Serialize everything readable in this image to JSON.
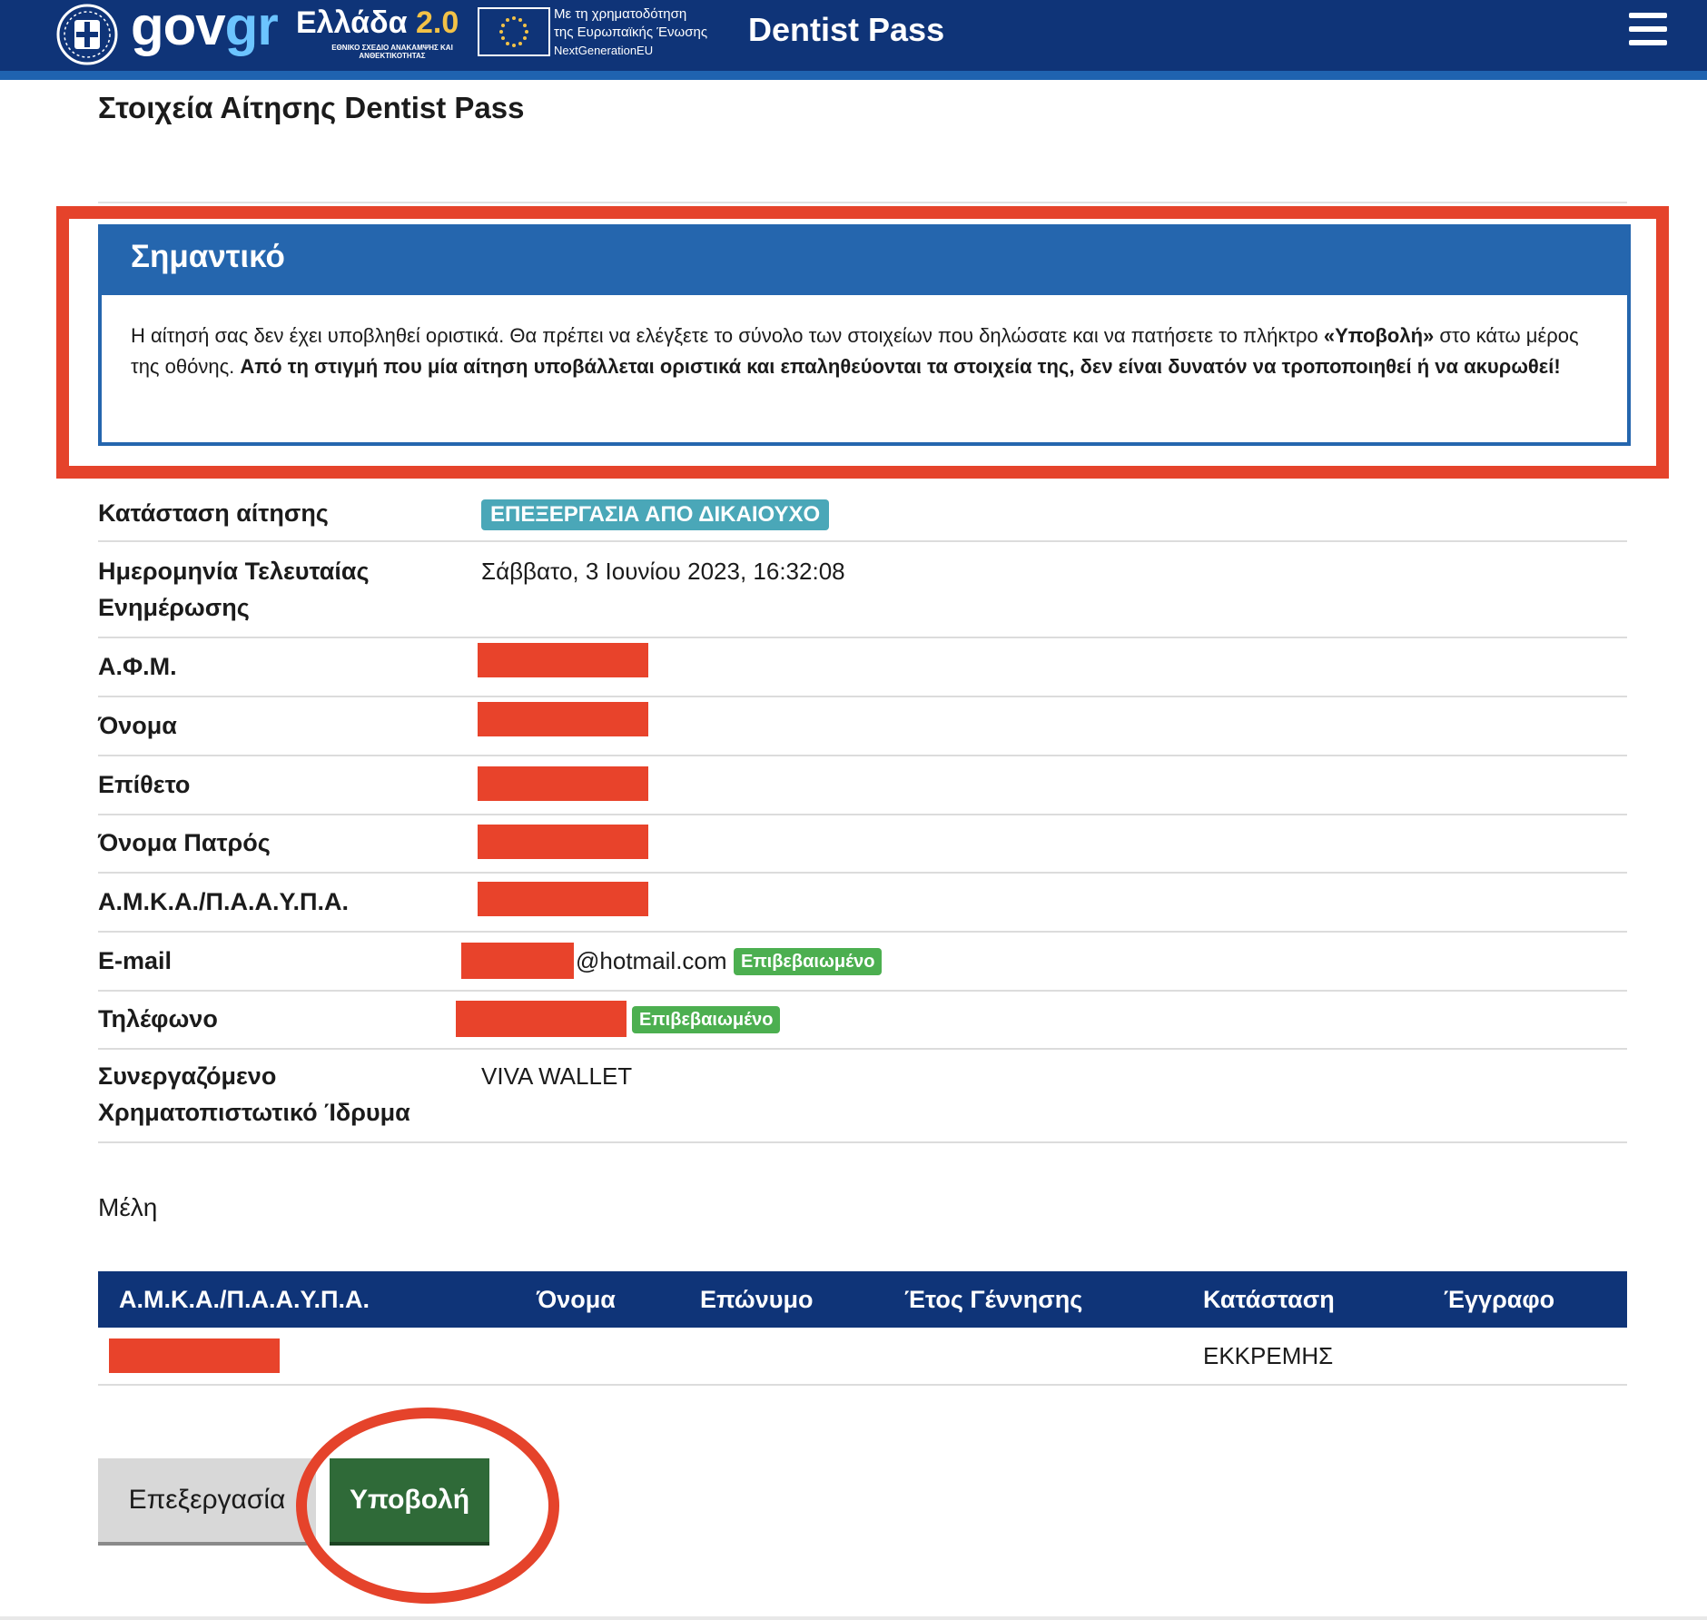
{
  "colors": {
    "header_bg": "#0f3478",
    "header_stripe": "#1f63b0",
    "notice_blue": "#2566ae",
    "annotation_red": "#e5432b",
    "status_teal": "#4aa7b8",
    "verified_green": "#4caf50",
    "submit_green": "#2f6a38"
  },
  "header": {
    "logo_gov": "gov",
    "logo_gr": "gr",
    "ellada_word": "Ελλάδα",
    "ellada_version": "2.0",
    "ellada_subtitle": "ΕΘΝΙΚΟ ΣΧΕΔΙΟ ΑΝΑΚΑΜΨΗΣ ΚΑΙ ΑΝΘΕΚΤΙΚΟΤΗΤΑΣ",
    "eu_line1": "Με τη χρηματοδότηση",
    "eu_line2": "της Ευρωπαϊκής Ένωσης",
    "eu_line3": "NextGenerationEU",
    "app_title": "Dentist Pass",
    "menu_icon": "hamburger-menu-icon"
  },
  "page_title": "Στοιχεία Αίτησης Dentist Pass",
  "notice": {
    "heading": "Σημαντικό",
    "text_part1": "Η αίτησή σας δεν έχει υποβληθεί οριστικά. Θα πρέπει να ελέγξετε το σύνολο των στοιχείων που δηλώσατε και να πατήσετε το πλήκτρο ",
    "text_bold_button": "«Υποβολή»",
    "text_part2": " στο κάτω μέρος της οθόνης. ",
    "text_bold_warning": "Από τη στιγμή που μία αίτηση υποβάλλεται οριστικά και επαληθεύονται τα στοιχεία της, δεν είναι δυνατόν να τροποποιηθεί ή να ακυρωθεί!"
  },
  "details": {
    "status_label": "Κατάσταση αίτησης",
    "status_value": "ΕΠΕΞΕΡΓΑΣΙΑ ΑΠΟ ΔΙΚΑΙΟΥΧΟ",
    "updated_label": "Ημερομηνία Τελευταίας Ενημέρωσης",
    "updated_value": "Σάββατο, 3 Ιουνίου 2023, 16:32:08",
    "afm_label": "Α.Φ.Μ.",
    "name_label": "Όνομα",
    "surname_label": "Επίθετο",
    "father_label": "Όνομα Πατρός",
    "amka_label": "Α.Μ.Κ.Α./Π.Α.Α.Υ.Π.Α.",
    "email_label": "E-mail",
    "email_visible_suffix": "@hotmail.com",
    "email_badge": "Επιβεβαιωμένο",
    "phone_label": "Τηλέφωνο",
    "phone_badge": "Επιβεβαιωμένο",
    "bank_label": "Συνεργαζόμενο Χρηματοπιστωτικό Ίδρυμα",
    "bank_value": "VIVA WALLET"
  },
  "members": {
    "title": "Μέλη",
    "columns": [
      "Α.Μ.Κ.Α./Π.Α.Α.Υ.Π.Α.",
      "Όνομα",
      "Επώνυμο",
      "Έτος Γέννησης",
      "Κατάσταση",
      "Έγγραφο"
    ],
    "rows": [
      {
        "amka": "",
        "name": "",
        "surname": "",
        "birth_year": "",
        "status": "ΕΚΚΡΕΜΗΣ",
        "document": ""
      }
    ]
  },
  "actions": {
    "edit_label": "Επεξεργασία",
    "submit_label": "Υποβολή"
  }
}
